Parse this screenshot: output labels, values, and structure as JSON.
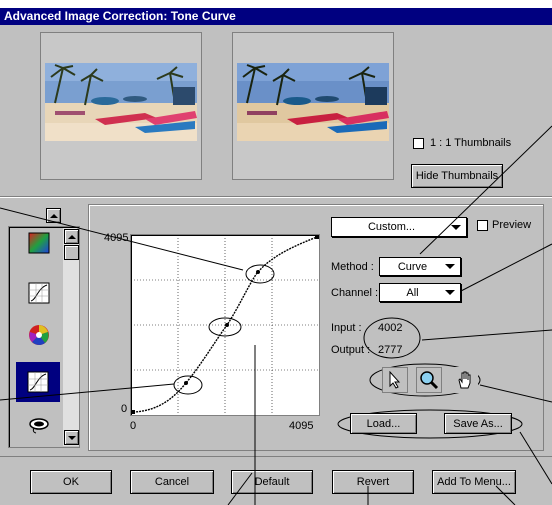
{
  "window": {
    "title": "Advanced Image Correction: Tone Curve"
  },
  "thumbnails": {
    "one_to_one_label": "1 : 1 Thumbnails",
    "one_to_one_checked": false,
    "hide_label": "Hide Thumbnails"
  },
  "preset": {
    "value": "Custom...",
    "preview_label": "Preview",
    "preview_checked": false
  },
  "method": {
    "label": "Method :",
    "value": "Curve"
  },
  "channel": {
    "label": "Channel :",
    "value": "All"
  },
  "readout": {
    "input_label": "Input :",
    "input_value": "4002",
    "output_label": "Output :",
    "output_value": "2777"
  },
  "curve": {
    "y_max_label": "4095",
    "y_min_label": "0",
    "x_min_label": "0",
    "x_max_label": "4095"
  },
  "tools": [
    "pointer-icon",
    "zoom-icon",
    "hand-icon"
  ],
  "file_buttons": {
    "load": "Load...",
    "save": "Save As..."
  },
  "bottom_buttons": {
    "ok": "OK",
    "cancel": "Cancel",
    "default": "Default",
    "revert": "Revert",
    "add_to_menu": "Add To Menu..."
  },
  "sidebar": {
    "items": [
      "color-balance-icon",
      "tone-curve-icon",
      "color-wheel-icon",
      "tone-curve-selected-icon",
      "lasso-icon"
    ]
  },
  "colors": {
    "title_bg": "#000080",
    "face": "#c0c0c0",
    "selected": "#000080"
  }
}
